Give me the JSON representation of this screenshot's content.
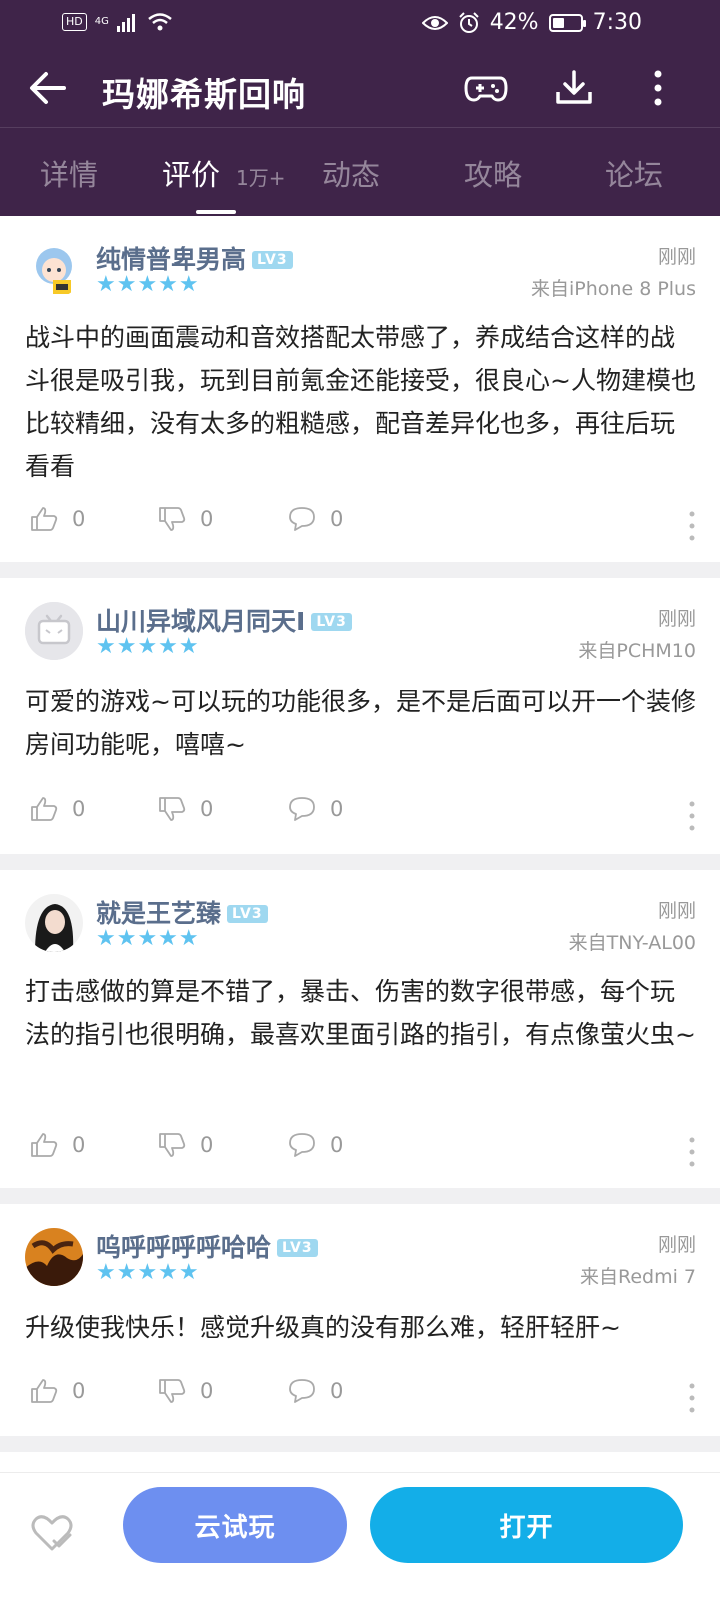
{
  "status_bar": {
    "hd": "HD",
    "net": "4G",
    "battery": "42%",
    "battery_level": 0.42,
    "time": "7:30"
  },
  "app_bar": {
    "title": "玛娜希斯回响"
  },
  "tabs": [
    {
      "label": "详情",
      "active": false
    },
    {
      "label": "评价",
      "active": true,
      "count": "1万+"
    },
    {
      "label": "动态",
      "active": false
    },
    {
      "label": "攻略",
      "active": false
    },
    {
      "label": "论坛",
      "active": false
    }
  ],
  "reviews": [
    {
      "user": "纯情普卑男高",
      "level": "LV3",
      "stars": "★★★★★",
      "rating": 5,
      "time": "刚刚",
      "device": "来自iPhone 8 Plus",
      "text": "战斗中的画面震动和音效搭配太带感了，养成结合这样的战斗很是吸引我，玩到目前氪金还能接受，很良心~人物建模也比较精细，没有太多的粗糙感，配音差异化也多，再往后玩看看",
      "likes": "0",
      "dislikes": "0",
      "comments": "0"
    },
    {
      "user": "山川异域风月同天I",
      "level": "LV3",
      "stars": "★★★★★",
      "rating": 5,
      "time": "刚刚",
      "device": "来自PCHM10",
      "text": "可爱的游戏~可以玩的功能很多，是不是后面可以开一个装修房间功能呢，嘻嘻~",
      "likes": "0",
      "dislikes": "0",
      "comments": "0"
    },
    {
      "user": "就是王艺臻",
      "level": "LV3",
      "stars": "★★★★★",
      "rating": 5,
      "time": "刚刚",
      "device": "来自TNY-AL00",
      "text": "打击感做的算是不错了，暴击、伤害的数字很带感，每个玩法的指引也很明确，最喜欢里面引路的指引，有点像萤火虫~",
      "likes": "0",
      "dislikes": "0",
      "comments": "0"
    },
    {
      "user": "呜呼呼呼呼哈哈",
      "level": "LV3",
      "stars": "★★★★★",
      "rating": 5,
      "time": "刚刚",
      "device": "来自Redmi 7",
      "text": "升级使我快乐！感觉升级真的没有那么难，轻肝轻肝~",
      "likes": "0",
      "dislikes": "0",
      "comments": "0"
    }
  ],
  "bottom_bar": {
    "cloud_play": "云试玩",
    "open": "打开"
  },
  "colors": {
    "header": "#3f2449",
    "accent_blue": "#13aee8",
    "cloud_blue": "#6d8ff0",
    "star": "#5fc3f0"
  }
}
